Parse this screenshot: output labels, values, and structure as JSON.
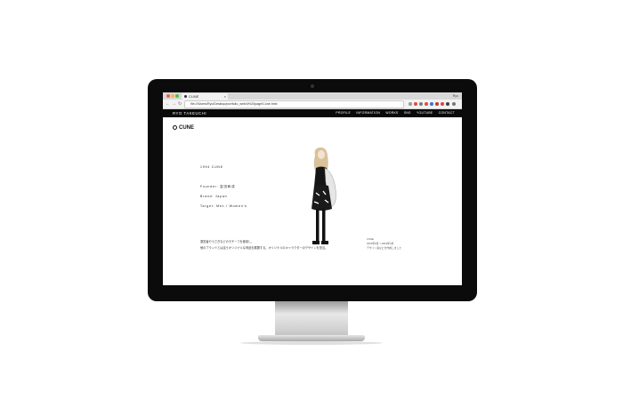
{
  "browser": {
    "tab_title": "CUNE",
    "user_label": "Ryo",
    "url": "file:///Users/Ryo/Desktop/portfolio_web/4%20page/Cune.html",
    "back_icon": "arrow-left-icon",
    "forward_icon": "arrow-right-icon",
    "reload_icon": "reload-icon"
  },
  "site": {
    "logo": "RYO TAKEUCHI",
    "menu": [
      "PROFILE",
      "INFORMATION",
      "WORKS",
      "SNS",
      "YOUTUBE",
      "CONTACT"
    ]
  },
  "page": {
    "brand": "CUNE",
    "heading": "1994 CUNE",
    "details": [
      "Founder: 富田和成",
      "Brand: Japan",
      "Target: Men / Women's"
    ],
    "description": [
      "運営者やうさぎなどのモチーフを使用し、",
      "他のブランドとは違うオリジナルな商品を展開する。オリジナルのキャラクターのデザインを担当。"
    ],
    "note": [
      "CUNE",
      "2015年8月 〜2016年3月",
      "デザイン案などを作成しました"
    ]
  },
  "colors": {
    "monitor_bezel": "#0b0b0b",
    "site_header": "#0a0a0a"
  }
}
